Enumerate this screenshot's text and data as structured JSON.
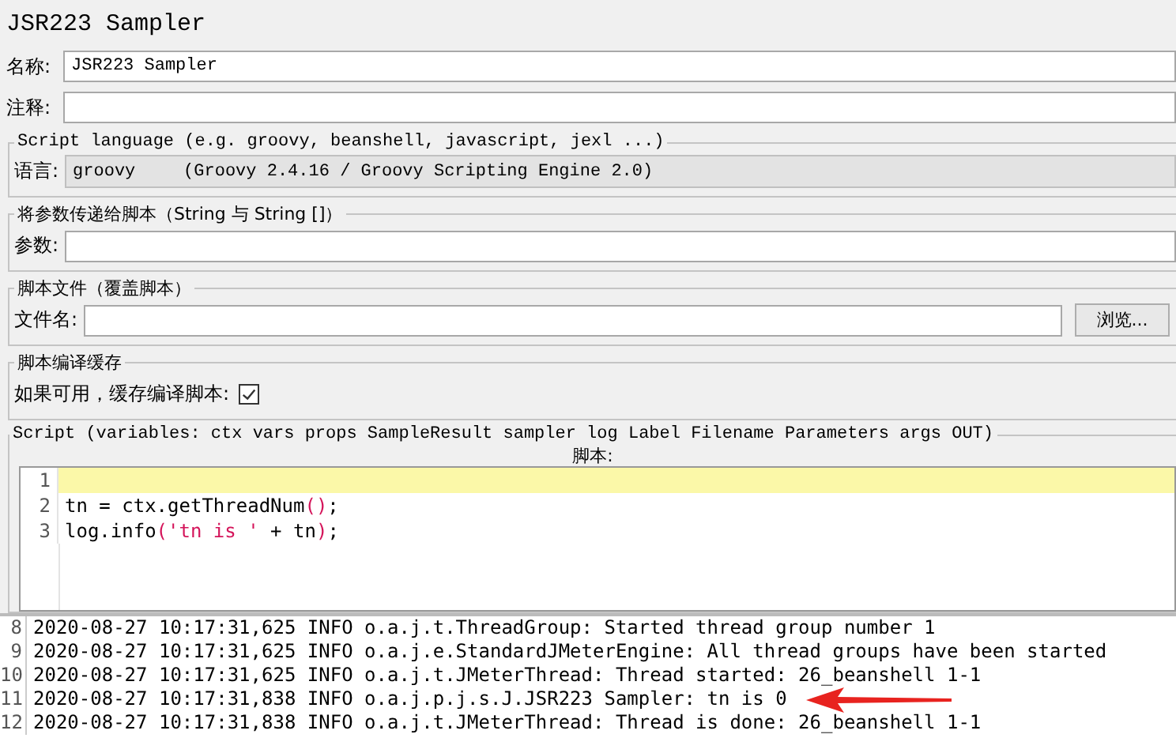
{
  "title": "JSR223 Sampler",
  "fields": [
    {
      "label": "名称:",
      "value": "JSR223 Sampler"
    },
    {
      "label": "注释:"
    }
  ],
  "language_group": {
    "legend": "Script language (e.g. groovy, beanshell, javascript, jexl ...)",
    "label": "语言:",
    "value": "groovy",
    "description": "(Groovy 2.4.16 / Groovy Scripting Engine 2.0)"
  },
  "parameters_group": {
    "legend": "将参数传递给脚本（String 与 String []）",
    "label": "参数:"
  },
  "file_group": {
    "legend": "脚本文件（覆盖脚本）",
    "label": "文件名:",
    "button": "浏览..."
  },
  "cache_group": {
    "legend": "脚本编译缓存",
    "label": "如果可用，缓存编译脚本:",
    "checked": true
  },
  "script_group": {
    "legend": "Script (variables: ctx vars props SampleResult sampler log Label Filename Parameters args OUT)",
    "label": "脚本:",
    "lines": [
      {
        "number": "1",
        "current": true
      },
      {
        "number": "2",
        "current": false,
        "segments": [
          {
            "kind": "plain",
            "text": "tn = ctx.getThreadNum"
          },
          {
            "kind": "accent",
            "text": "()"
          },
          {
            "kind": "plain",
            "text": ";"
          }
        ]
      },
      {
        "number": "3",
        "current": false,
        "segments": [
          {
            "kind": "plain",
            "text": "log.info"
          },
          {
            "kind": "accent",
            "text": "('tn is '"
          },
          {
            "kind": "plain",
            "text": " + tn"
          },
          {
            "kind": "accent",
            "text": ")"
          },
          {
            "kind": "plain",
            "text": ";"
          }
        ]
      }
    ]
  },
  "log": [
    {
      "number": "8",
      "text": "2020-08-27 10:17:31,625 INFO o.a.j.t.ThreadGroup: Started thread group number 1",
      "pointed": false
    },
    {
      "number": "9",
      "text": "2020-08-27 10:17:31,625 INFO o.a.j.e.StandardJMeterEngine: All thread groups have been started",
      "pointed": false
    },
    {
      "number": "10",
      "text": "2020-08-27 10:17:31,625 INFO o.a.j.t.JMeterThread: Thread started: 26_beanshell 1-1",
      "pointed": false
    },
    {
      "number": "11",
      "text": "2020-08-27 10:17:31,838 INFO o.a.j.p.j.s.J.JSR223 Sampler: tn is 0",
      "pointed": true
    },
    {
      "number": "12",
      "text": "2020-08-27 10:17:31,838 INFO o.a.j.t.JMeterThread: Thread is done: 26_beanshell 1-1",
      "pointed": false
    }
  ]
}
